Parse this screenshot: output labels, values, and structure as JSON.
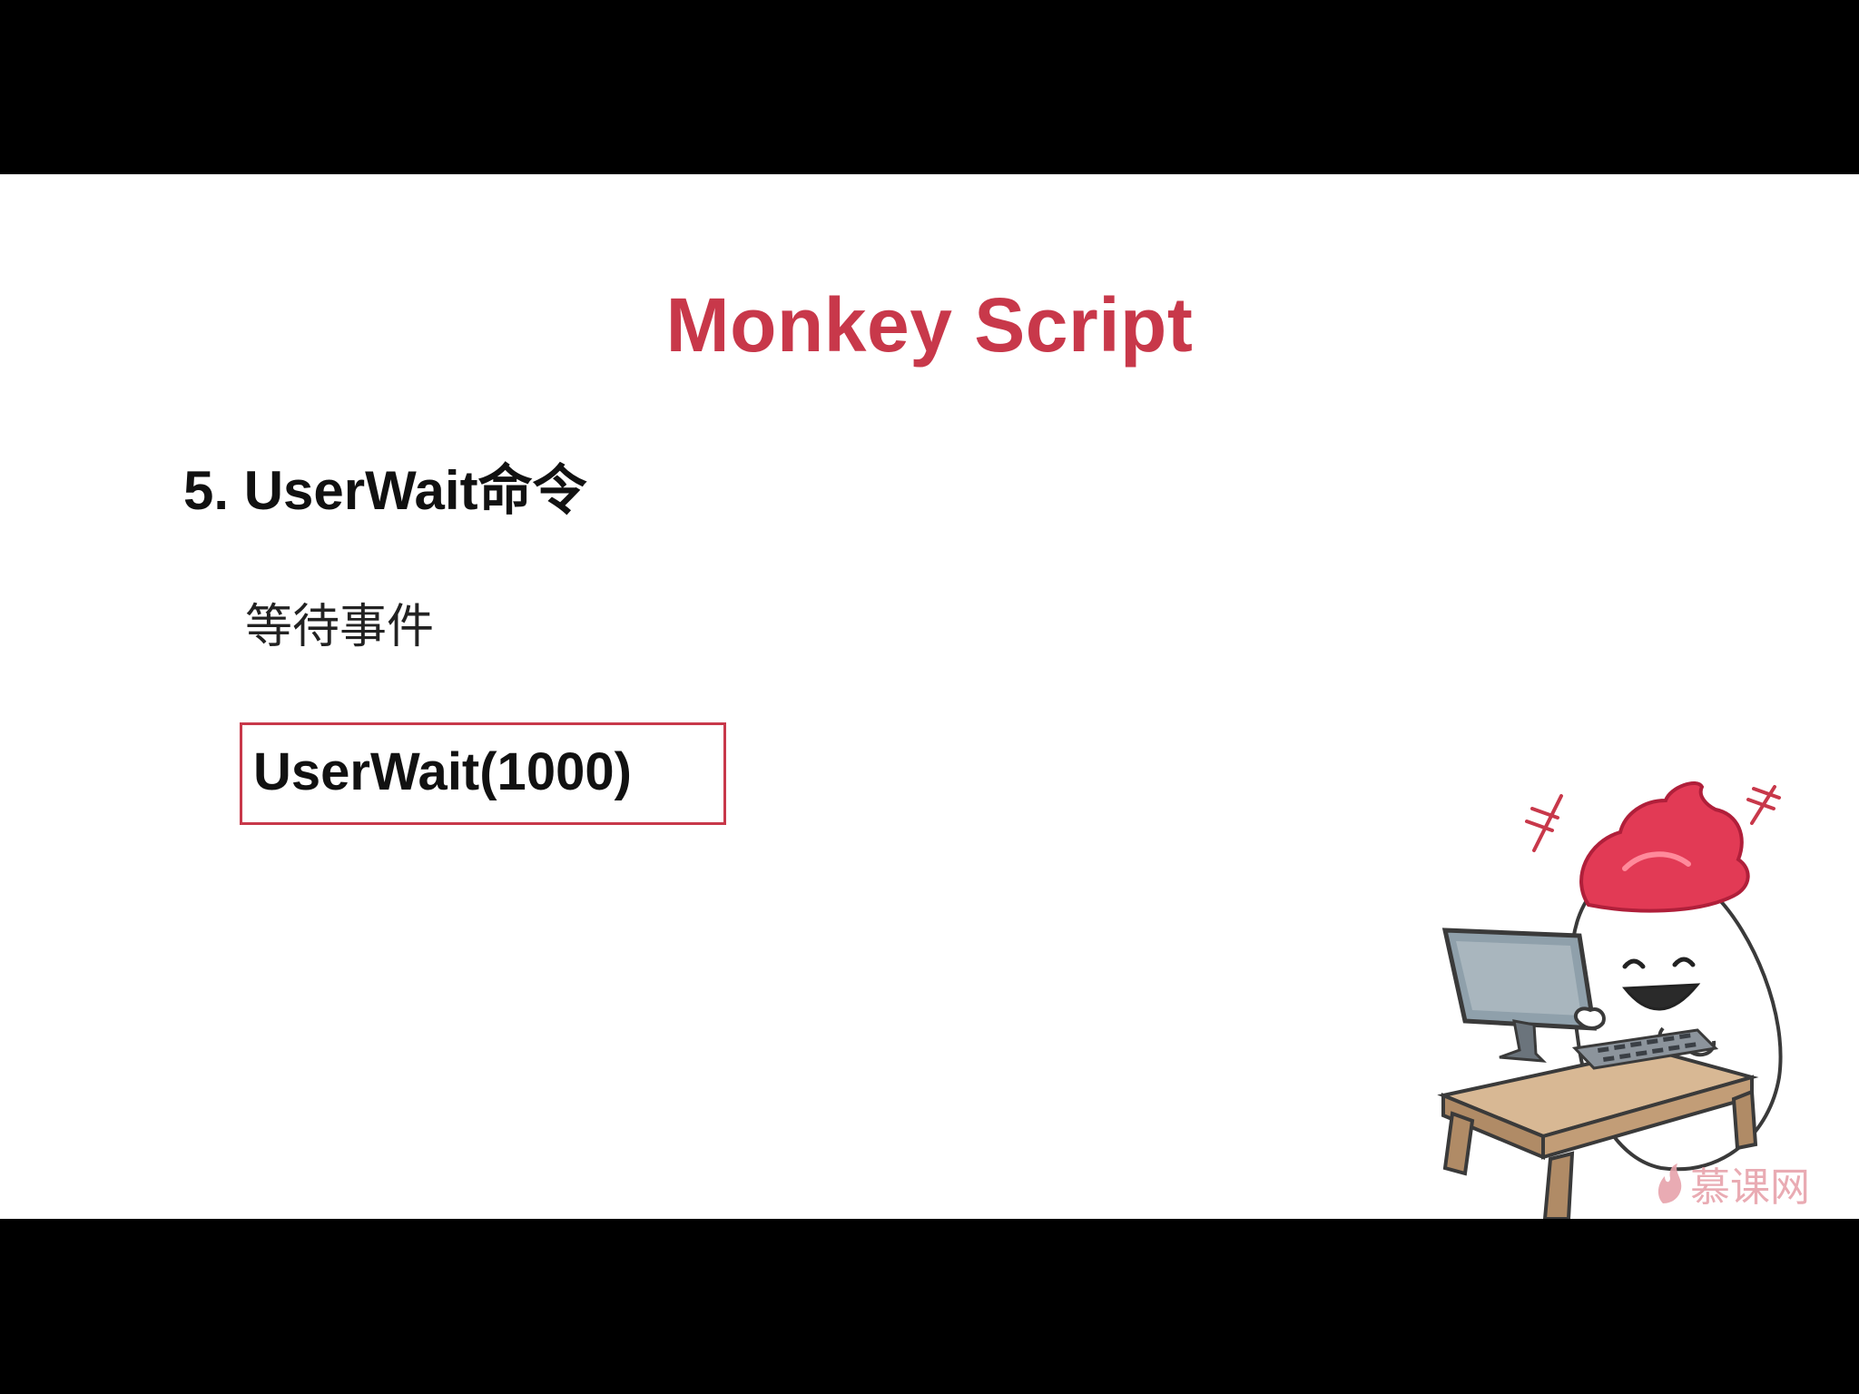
{
  "slide": {
    "title": "Monkey Script",
    "heading": "5. UserWait命令",
    "description": "等待事件",
    "code": "UserWait(1000)"
  },
  "watermark": {
    "text": "慕课网",
    "icon": "flame-logo-icon"
  },
  "colors": {
    "accent": "#c8384a",
    "text": "#111111",
    "background": "#ffffff",
    "letterbox": "#000000"
  },
  "illustration": {
    "icon": "mascot-at-computer-illustration"
  }
}
